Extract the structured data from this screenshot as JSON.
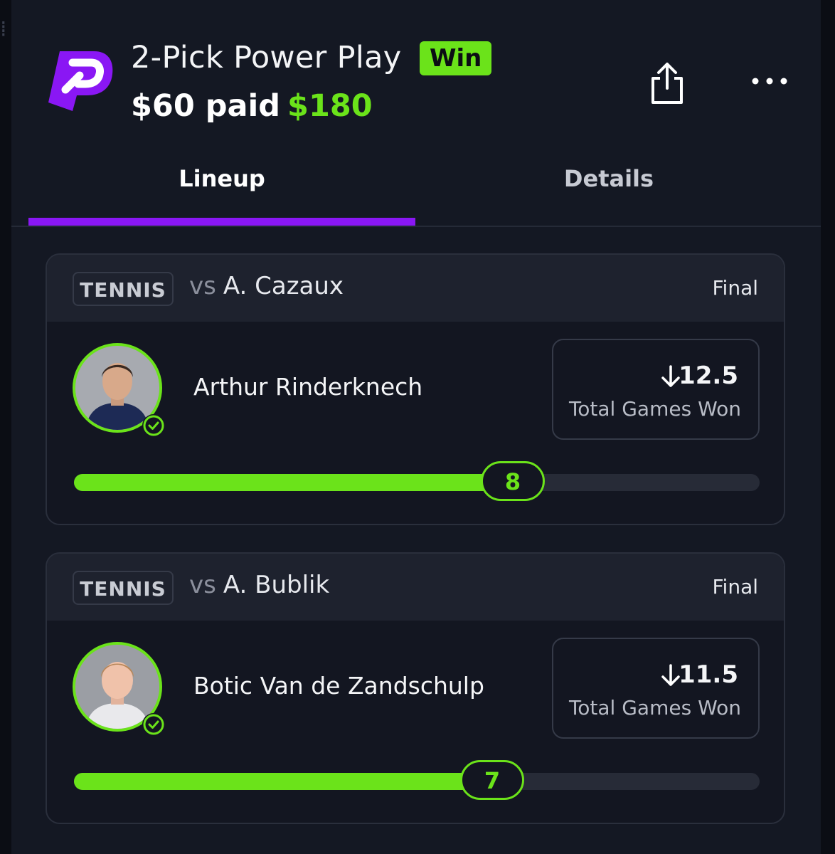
{
  "header": {
    "title": "2-Pick Power Play",
    "result_badge": "Win",
    "paid_text": "$60 paid",
    "won_amount": "$180",
    "logo_icon": "prizepicks-logo-icon",
    "share_icon": "share-icon",
    "more_icon": "more-options-icon"
  },
  "tabs": [
    {
      "label": "Lineup",
      "active": true
    },
    {
      "label": "Details",
      "active": false
    }
  ],
  "colors": {
    "accent_green": "#6be31a",
    "accent_purple": "#8a17f4",
    "background": "#141823"
  },
  "picks": [
    {
      "sport": "TENNIS",
      "vs_label": "vs",
      "opponent": "A. Cazaux",
      "status": "Final",
      "player": "Arthur Rinderknech",
      "direction_icon": "arrow-down-icon",
      "line": "12.5",
      "stat": "Total Games Won",
      "actual": "8",
      "progress": 0.64
    },
    {
      "sport": "TENNIS",
      "vs_label": "vs",
      "opponent": "A. Bublik",
      "status": "Final",
      "player": "Botic Van de Zandschulp",
      "direction_icon": "arrow-down-icon",
      "line": "11.5",
      "stat": "Total Games Won",
      "actual": "7",
      "progress": 0.61
    }
  ]
}
